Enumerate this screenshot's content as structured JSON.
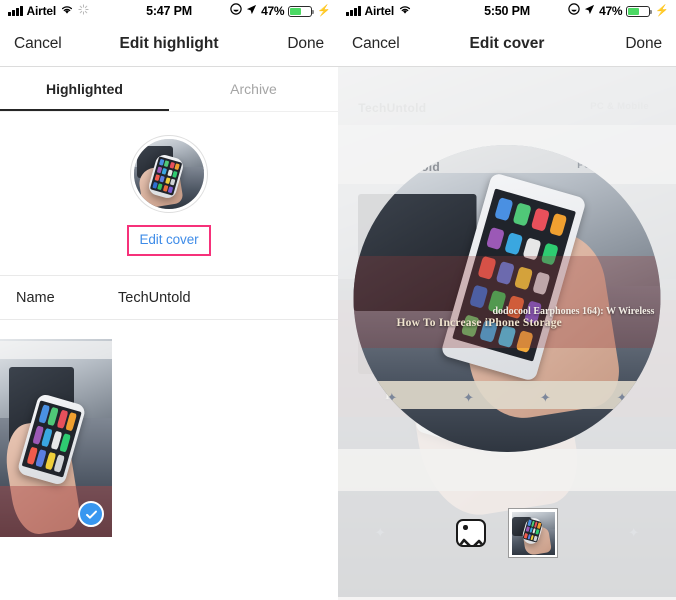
{
  "left_screen": {
    "statusbar": {
      "carrier": "Airtel",
      "time": "5:47 PM",
      "battery_pct": "47%",
      "icons": [
        "signal-bars-icon",
        "wifi-icon",
        "brightness-spinner-icon",
        "location-arrow-icon",
        "do-not-disturb-icon",
        "battery-icon",
        "charging-bolt-icon"
      ]
    },
    "navbar": {
      "cancel_label": "Cancel",
      "title": "Edit highlight",
      "done_label": "Done"
    },
    "tabs": [
      {
        "label": "Highlighted",
        "active": true
      },
      {
        "label": "Archive",
        "active": false
      }
    ],
    "cover": {
      "edit_cover_label": "Edit cover",
      "highlight_box_color": "#f6317a",
      "link_color": "#3f8ce8"
    },
    "name_row": {
      "label": "Name",
      "value": "TechUntold"
    },
    "stories": [
      {
        "selected": true,
        "check_color": "#3897f0"
      }
    ]
  },
  "right_screen": {
    "statusbar": {
      "carrier": "Airtel",
      "time": "5:50 PM",
      "battery_pct": "47%",
      "icons": [
        "signal-bars-icon",
        "wifi-icon",
        "location-arrow-icon",
        "do-not-disturb-icon",
        "battery-icon",
        "charging-bolt-icon"
      ]
    },
    "navbar": {
      "cancel_label": "Cancel",
      "title": "Edit cover",
      "done_label": "Done"
    },
    "picker": {
      "gallery_icon": "photo-gallery-icon",
      "thumbnail_selected": true
    },
    "annotation": {
      "arrow_color": "#f6317a",
      "arrow_target": "photo-gallery-icon"
    }
  },
  "photo": {
    "brand": "TechUntold",
    "menu": "PC & Mobile",
    "caption": "How To Increase iPhone Storage",
    "side_headline": "dodocool\nEarphones\n164): W\nWireless"
  }
}
